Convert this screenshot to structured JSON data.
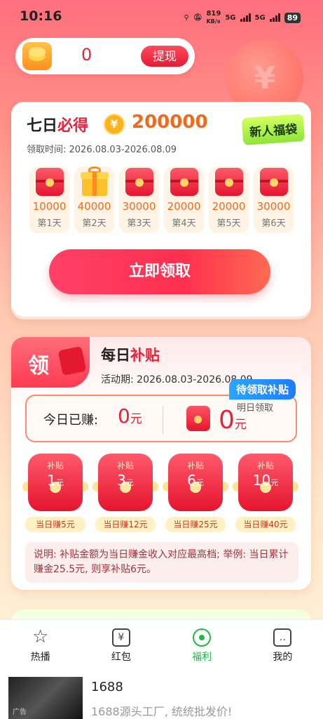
{
  "status_bar": {
    "time": "10:16",
    "speed": "819",
    "speed_unit": "KB/s",
    "net1": "5G",
    "net2": "5G",
    "battery": "89"
  },
  "wallet": {
    "balance": "0",
    "withdraw_label": "提现"
  },
  "seven_day": {
    "title_prefix": "七日",
    "title_highlight": "必得",
    "coin_symbol": "¥",
    "amount": "200000",
    "date_range": "领取时间: 2026.08.03-2026.08.09",
    "tag": "新人福袋",
    "days": [
      {
        "value": "10000",
        "label": "第1天",
        "icon": "red-envelope-icon"
      },
      {
        "value": "40000",
        "label": "第2天",
        "icon": "gift-box-icon"
      },
      {
        "value": "30000",
        "label": "第3天",
        "icon": "red-envelope-icon"
      },
      {
        "value": "20000",
        "label": "第4天",
        "icon": "red-envelope-icon"
      },
      {
        "value": "20000",
        "label": "第5天",
        "icon": "red-envelope-icon"
      },
      {
        "value": "30000",
        "label": "第6天",
        "icon": "red-envelope-icon"
      }
    ],
    "claim_label": "立即领取"
  },
  "daily_subsidy": {
    "badge": "领",
    "title_prefix": "每日",
    "title_highlight": "补贴",
    "date_range": "活动期: 2026.08.03-2026.08.09",
    "pending_tag": "待领取补贴",
    "earned_label": "今日已赚:",
    "earned_value": "0",
    "unit": "元",
    "tomorrow_label": "明日领取",
    "tomorrow_value": "0",
    "tiers": [
      {
        "top": "补贴",
        "value": "1",
        "unit": "元",
        "condition": "当日赚5元"
      },
      {
        "top": "补贴",
        "value": "3",
        "unit": "元",
        "condition": "当日赚12元"
      },
      {
        "top": "补贴",
        "value": "6",
        "unit": "元",
        "condition": "当日赚25元"
      },
      {
        "top": "补贴",
        "value": "10",
        "unit": "元",
        "condition": "当日赚40元"
      }
    ],
    "note": "说明: 补贴金额为当日赚金收入对应最高档; 举例: 当日累计赚金25.5元, 则享补贴6元。"
  },
  "tabbar": {
    "items": [
      {
        "label": "热播",
        "icon": "star-play-icon"
      },
      {
        "label": "红包",
        "icon": "yuan-box-icon"
      },
      {
        "label": "福利",
        "icon": "welfare-circle-icon",
        "active": true
      },
      {
        "label": "我的",
        "icon": "profile-box-icon"
      }
    ]
  },
  "ad": {
    "title": "1688",
    "description": "1688源头工厂, 统统批发价!",
    "thumb_label": "广告"
  },
  "colors": {
    "accent": "#e5243b",
    "orange": "#ee6a1c",
    "active_tab": "#1fb84a"
  }
}
